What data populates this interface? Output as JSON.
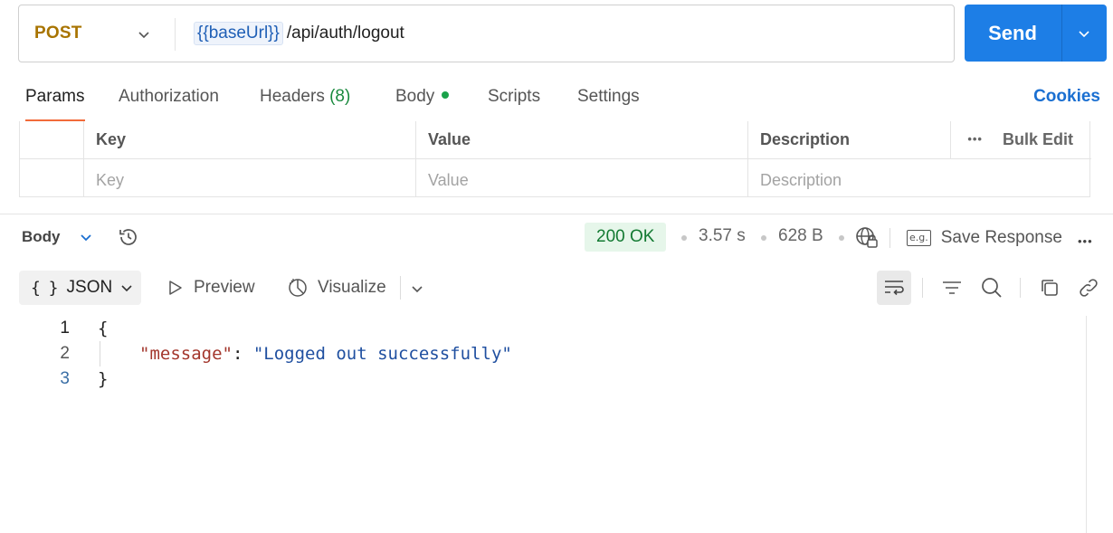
{
  "request": {
    "method": "POST",
    "url_variable": "{{baseUrl}}",
    "url_path": "/api/auth/logout",
    "send_label": "Send"
  },
  "tabs": [
    {
      "label": "Params"
    },
    {
      "label": "Authorization"
    },
    {
      "label": "Headers",
      "count": "(8)"
    },
    {
      "label": "Body"
    },
    {
      "label": "Scripts"
    },
    {
      "label": "Settings"
    }
  ],
  "cookies_label": "Cookies",
  "params_table": {
    "headers": [
      "Key",
      "Value",
      "Description"
    ],
    "bulk_edit": "Bulk Edit",
    "more": "•••",
    "placeholders": [
      "Key",
      "Value",
      "Description"
    ]
  },
  "response": {
    "section_label": "Body",
    "status": "200 OK",
    "time": "3.57 s",
    "size": "628 B",
    "save_label": "Save Response",
    "save_icon_text": "e.g.",
    "more": "•••",
    "format_brace": "{ }",
    "format_label": "JSON",
    "preview_label": "Preview",
    "visualize_label": "Visualize"
  },
  "code": {
    "lines": [
      {
        "num": "1",
        "text": "{"
      },
      {
        "num": "2",
        "key": "\"message\"",
        "sep": ": ",
        "value": "\"Logged out successfully\""
      },
      {
        "num": "3",
        "text": "}"
      }
    ]
  },
  "colors": {
    "send": "#1d7ee6",
    "method": "#a87400",
    "status_bg": "#e6f6ea",
    "status_text": "#137a32",
    "active_tab_underline": "#f26b3a",
    "cookies": "#1a6fd1"
  }
}
